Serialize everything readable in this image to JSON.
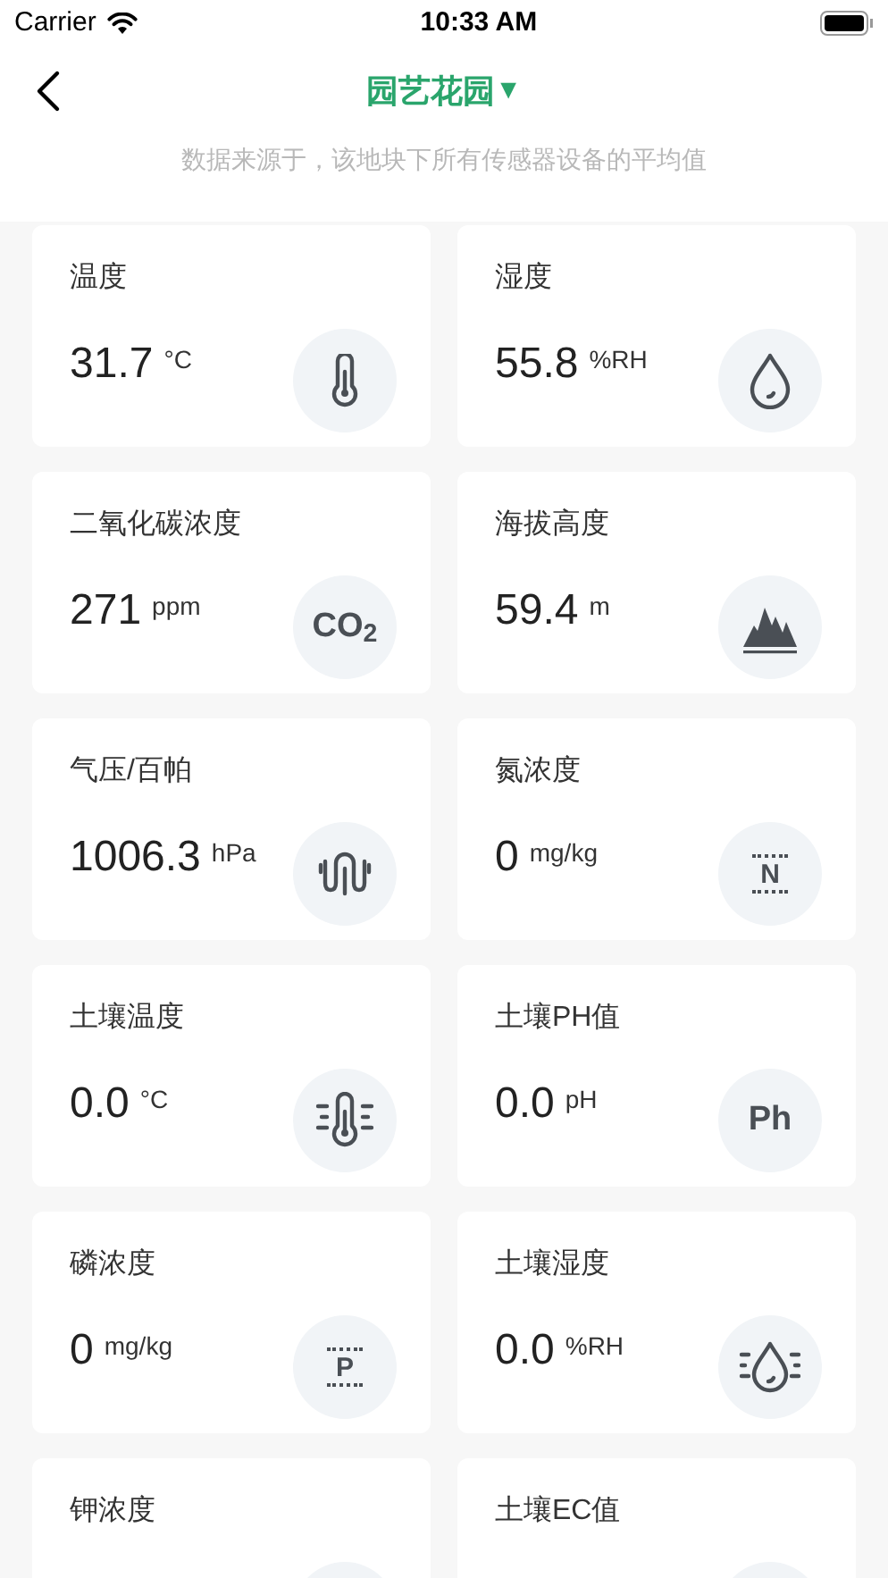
{
  "status_bar": {
    "carrier": "Carrier",
    "time": "10:33 AM"
  },
  "nav": {
    "title": "园艺花园",
    "dropdown_mark": "▼"
  },
  "subtitle": "数据来源于，该地块下所有传感器设备的平均值",
  "cards": [
    {
      "label": "温度",
      "value": "31.7",
      "unit": "°C",
      "icon": {
        "kind": "thermometer"
      }
    },
    {
      "label": "湿度",
      "value": "55.8",
      "unit": "%RH",
      "icon": {
        "kind": "drop"
      }
    },
    {
      "label": "二氧化碳浓度",
      "value": "271",
      "unit": "ppm",
      "icon": {
        "kind": "text",
        "text": "CO$_{2}$"
      }
    },
    {
      "label": "海拔高度",
      "value": "59.4",
      "unit": "m",
      "icon": {
        "kind": "mountain"
      }
    },
    {
      "label": "气压/百帕",
      "value": "1006.3",
      "unit": "hPa",
      "icon": {
        "kind": "pressure"
      }
    },
    {
      "label": "氮浓度",
      "value": "0",
      "unit": "mg/kg",
      "icon": {
        "kind": "lined_text",
        "text": "N"
      }
    },
    {
      "label": "土壤温度",
      "value": "0.0",
      "unit": "°C",
      "icon": {
        "kind": "soil_thermometer"
      }
    },
    {
      "label": "土壤PH值",
      "value": "0.0",
      "unit": "pH",
      "icon": {
        "kind": "text",
        "text": "Ph"
      }
    },
    {
      "label": "磷浓度",
      "value": "0",
      "unit": "mg/kg",
      "icon": {
        "kind": "lined_text",
        "text": "P"
      }
    },
    {
      "label": "土壤湿度",
      "value": "0.0",
      "unit": "%RH",
      "icon": {
        "kind": "soil_drop"
      }
    },
    {
      "label": "钾浓度"
    },
    {
      "label": "土壤EC值"
    }
  ]
}
